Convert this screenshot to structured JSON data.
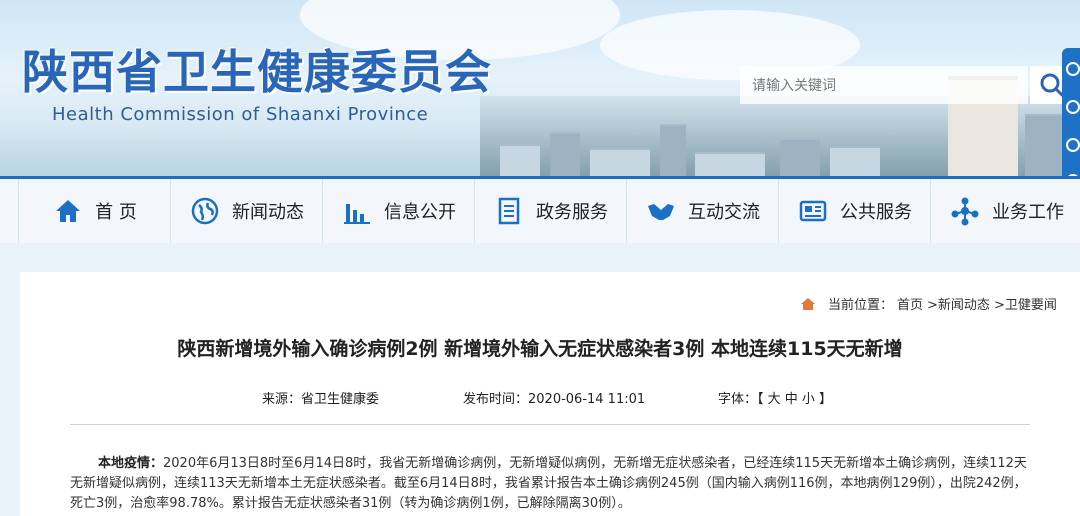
{
  "header": {
    "title_cn": "陕西省卫生健康委员会",
    "title_en": "Health Commission of Shaanxi Province",
    "search_placeholder": "请输入关键词"
  },
  "nav": {
    "items": [
      {
        "label": "首 页",
        "icon": "home-icon"
      },
      {
        "label": "新闻动态",
        "icon": "globe-icon"
      },
      {
        "label": "信息公开",
        "icon": "bar-chart-icon"
      },
      {
        "label": "政务服务",
        "icon": "document-icon"
      },
      {
        "label": "互动交流",
        "icon": "handshake-icon"
      },
      {
        "label": "公共服务",
        "icon": "newspaper-icon"
      },
      {
        "label": "业务工作",
        "icon": "network-icon"
      }
    ]
  },
  "breadcrumb": {
    "prefix": "当前位置：",
    "items": [
      "首页",
      ">新闻动态",
      ">卫健要闻"
    ]
  },
  "article": {
    "title": "陕西新增境外输入确诊病例2例 新增境外输入无症状感染者3例 本地连续115天无新增",
    "source_label": "来源：省卫生健康委",
    "date_label": "发布时间：2020-06-14 11:01",
    "font_label": "字体：【 大 中 小 】",
    "para_lead": "本地疫情：",
    "para_text": "2020年6月13日8时至6月14日8时，我省无新增确诊病例，无新增疑似病例，无新增无症状感染者，已经连续115天无新增本土确诊病例，连续112天无新增疑似病例，连续113天无新增本土无症状感染者。截至6月14日8时，我省累计报告本土确诊病例245例（国内输入病例116例，本地病例129例），出院242例，死亡3例，治愈率98.78%。累计报告无症状感染者31例（转为确诊病例1例，已解除隔离30例）。"
  },
  "colors": {
    "brand_blue": "#1b6fc4",
    "title_blue": "#2a66b8",
    "breadcrumb_home": "#e07b3c"
  }
}
